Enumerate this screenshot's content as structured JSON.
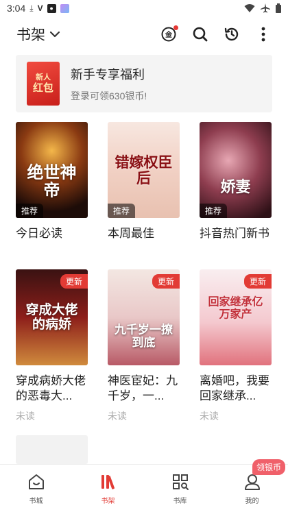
{
  "status_bar": {
    "time": "3:04",
    "icons": [
      "download-icon",
      "v-icon",
      "app-icon",
      "gradient-app-icon",
      "wifi-icon",
      "airplane-icon",
      "battery-icon"
    ]
  },
  "header": {
    "title": "书架",
    "actions": [
      "gold-coin-icon",
      "search-icon",
      "history-icon",
      "more-icon"
    ]
  },
  "banner": {
    "badge_line1": "新人",
    "badge_line2": "红包",
    "title": "新手专享福利",
    "subtitle": "登录可领630银币!"
  },
  "books": [
    {
      "name": "今日必读",
      "cover_title": "绝世神帝",
      "tag": "推荐",
      "status": ""
    },
    {
      "name": "本周最佳",
      "cover_title": "错嫁权臣后",
      "tag": "推荐",
      "status": ""
    },
    {
      "name": "抖音热门新书",
      "cover_title": "娇妻",
      "tag": "推荐",
      "status": ""
    },
    {
      "name": "穿成病娇大佬的恶毒大...",
      "cover_title": "穿成大佬的病娇",
      "tag": "更新",
      "status": "未读"
    },
    {
      "name": "神医宦妃：九千岁，一...",
      "cover_title": "九千岁一撩到底",
      "tag": "更新",
      "status": "未读"
    },
    {
      "name": "离婚吧，我要回家继承...",
      "cover_title": "回家继承亿万家产",
      "tag": "更新",
      "status": "未读"
    }
  ],
  "bottom_nav": {
    "items": [
      {
        "label": "书城",
        "icon": "home-icon"
      },
      {
        "label": "书架",
        "icon": "bookshelf-icon"
      },
      {
        "label": "书库",
        "icon": "library-icon"
      },
      {
        "label": "我的",
        "icon": "profile-icon"
      }
    ],
    "badge": "领银币"
  },
  "colors": {
    "accent": "#e23b35",
    "muted": "#aaaaaa",
    "banner_bg": "#f4f4f4"
  }
}
